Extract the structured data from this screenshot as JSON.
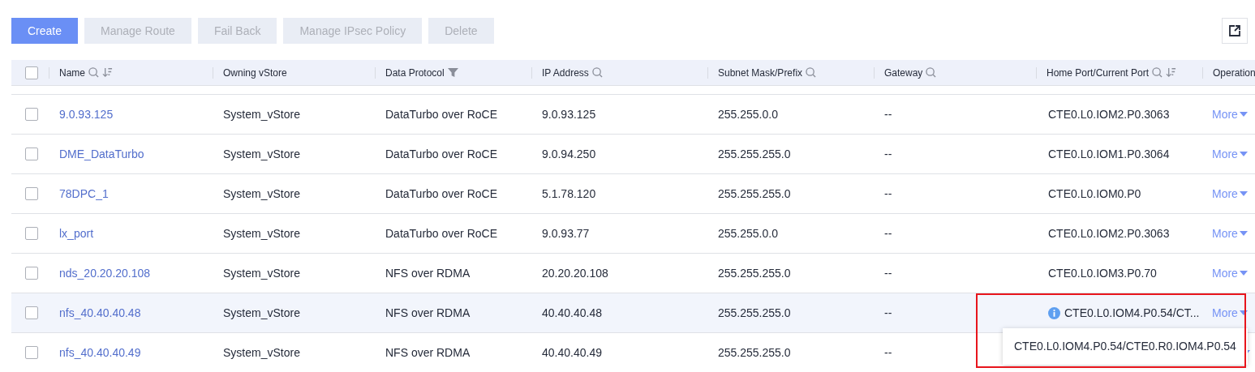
{
  "toolbar": {
    "buttons": [
      {
        "label": "Create",
        "disabled": false
      },
      {
        "label": "Manage Route",
        "disabled": true
      },
      {
        "label": "Fail Back",
        "disabled": true
      },
      {
        "label": "Manage IPsec Policy",
        "disabled": true
      },
      {
        "label": "Delete",
        "disabled": true
      }
    ]
  },
  "table": {
    "select_all": {
      "checked": false
    },
    "columns": [
      {
        "label": "Name",
        "searchable": true,
        "sortable": true
      },
      {
        "label": "Owning vStore"
      },
      {
        "label": "Data Protocol",
        "filterable": true
      },
      {
        "label": "IP Address",
        "searchable": true
      },
      {
        "label": "Subnet Mask/Prefix",
        "searchable": true
      },
      {
        "label": "Gateway",
        "searchable": true
      },
      {
        "label": "Home Port/Current Port",
        "searchable": true,
        "sortable": true
      },
      {
        "label": "Operation"
      }
    ],
    "rows": [
      {
        "checked": false,
        "hovered": false,
        "cells": [
          "9.0.93.125",
          "System_vStore",
          "DataTurbo over RoCE",
          "9.0.93.125",
          "255.255.0.0",
          "--",
          "CTE0.L0.IOM2.P0.3063"
        ],
        "port_info": false,
        "operation": "More"
      },
      {
        "checked": false,
        "hovered": false,
        "cells": [
          "DME_DataTurbo",
          "System_vStore",
          "DataTurbo over RoCE",
          "9.0.94.250",
          "255.255.255.0",
          "--",
          "CTE0.L0.IOM1.P0.3064"
        ],
        "port_info": false,
        "operation": "More"
      },
      {
        "checked": false,
        "hovered": false,
        "cells": [
          "78DPC_1",
          "System_vStore",
          "DataTurbo over RoCE",
          "5.1.78.120",
          "255.255.255.0",
          "--",
          "CTE0.L0.IOM0.P0"
        ],
        "port_info": false,
        "operation": "More"
      },
      {
        "checked": false,
        "hovered": false,
        "cells": [
          "lx_port",
          "System_vStore",
          "DataTurbo over RoCE",
          "9.0.93.77",
          "255.255.0.0",
          "--",
          "CTE0.L0.IOM2.P0.3063"
        ],
        "port_info": false,
        "operation": "More"
      },
      {
        "checked": false,
        "hovered": false,
        "cells": [
          "nds_20.20.20.108",
          "System_vStore",
          "NFS over RDMA",
          "20.20.20.108",
          "255.255.255.0",
          "--",
          "CTE0.L0.IOM3.P0.70"
        ],
        "port_info": false,
        "operation": "More"
      },
      {
        "checked": false,
        "hovered": true,
        "cells": [
          "nfs_40.40.40.48",
          "System_vStore",
          "NFS over RDMA",
          "40.40.40.48",
          "255.255.255.0",
          "--",
          "CTE0.L0.IOM4.P0.54/CT..."
        ],
        "port_info": true,
        "operation": "More"
      },
      {
        "checked": false,
        "hovered": false,
        "cells": [
          "nfs_40.40.40.49",
          "System_vStore",
          "NFS over RDMA",
          "40.40.40.49",
          "255.255.255.0",
          "--"
        ]
      }
    ]
  },
  "tooltip": {
    "text": "CTE0.L0.IOM4.P0.54/CTE0.R0.IOM4.P0.54"
  }
}
